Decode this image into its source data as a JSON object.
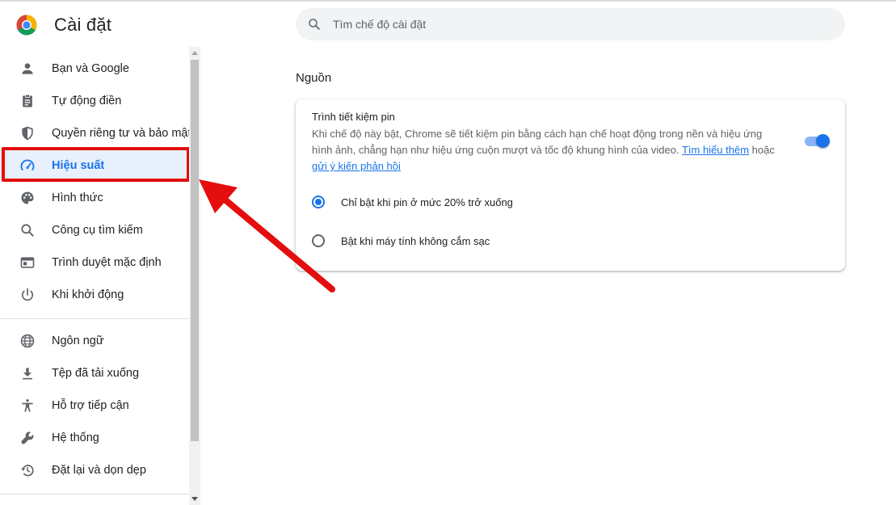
{
  "app": {
    "title": "Cài đặt",
    "logo_icon": "chrome-logo"
  },
  "search": {
    "placeholder": "Tìm chế độ cài đặt",
    "value": ""
  },
  "sidebar": {
    "active_item": "Hiệu suất",
    "items": [
      {
        "label": "Bạn và Google",
        "icon": "person-icon"
      },
      {
        "label": "Tự động điền",
        "icon": "clipboard-icon"
      },
      {
        "label": "Quyền riêng tư và bảo mật",
        "icon": "shield-icon"
      },
      {
        "label": "Hiệu suất",
        "icon": "speedometer-icon"
      },
      {
        "label": "Hình thức",
        "icon": "palette-icon"
      },
      {
        "label": "Công cụ tìm kiếm",
        "icon": "search-icon"
      },
      {
        "label": "Trình duyệt mặc định",
        "icon": "browser-window-icon"
      },
      {
        "label": "Khi khởi động",
        "icon": "power-icon"
      },
      {
        "label": "Ngôn ngữ",
        "icon": "globe-icon"
      },
      {
        "label": "Tệp đã tải xuống",
        "icon": "download-icon"
      },
      {
        "label": "Hỗ trợ tiếp cận",
        "icon": "accessibility-icon"
      },
      {
        "label": "Hệ thống",
        "icon": "wrench-icon"
      },
      {
        "label": "Đặt lại và dọn dẹp",
        "icon": "restore-icon"
      }
    ]
  },
  "main": {
    "section_title": "Nguồn",
    "card": {
      "title": "Trình tiết kiệm pin",
      "description": "Khi chế độ này bật, Chrome sẽ tiết kiệm pin bằng cách hạn chế hoạt động trong nền và hiệu ứng hình ảnh, chẳng hạn như hiệu ứng cuộn mượt và tốc độ khung hình của video.",
      "learn_more_link": "Tìm hiểu thêm",
      "or_text": "hoặc",
      "feedback_link": "gửi ý kiến phản hồi",
      "toggle_on": true,
      "options": [
        {
          "label": "Chỉ bật khi pin ở mức 20% trở xuống",
          "checked": true
        },
        {
          "label": "Bật khi máy tính không cắm sạc",
          "checked": false
        }
      ]
    }
  },
  "colors": {
    "accent": "#1a73e8",
    "annotation": "#e40e0e",
    "active_bg": "#e8f0fe"
  }
}
